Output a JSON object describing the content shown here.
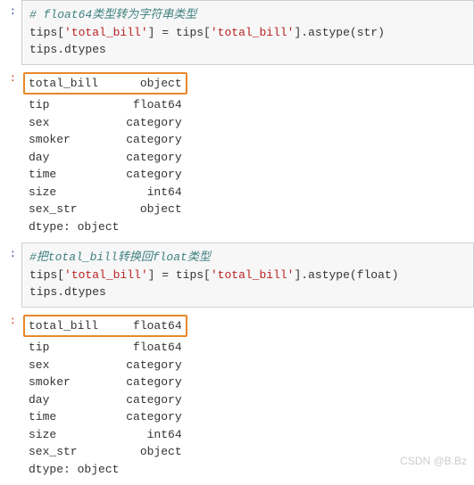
{
  "cell1": {
    "comment": "# float64类型转为字符串类型",
    "code_line1_a": "tips[",
    "code_line1_b": "'total_bill'",
    "code_line1_c": "] = tips[",
    "code_line1_d": "'total_bill'",
    "code_line1_e": "].astype(",
    "code_line1_f": "str",
    "code_line1_g": ")",
    "code_line2": "tips.dtypes"
  },
  "out1": {
    "highlight": "total_bill      object",
    "rows": [
      "tip            float64",
      "sex           category",
      "smoker        category",
      "day           category",
      "time          category",
      "size             int64",
      "sex_str         object",
      "dtype: object"
    ]
  },
  "cell2": {
    "comment": "#把total_bill转换回float类型",
    "code_line1_a": "tips[",
    "code_line1_b": "'total_bill'",
    "code_line1_c": "] = tips[",
    "code_line1_d": "'total_bill'",
    "code_line1_e": "].astype(",
    "code_line1_f": "float",
    "code_line1_g": ")",
    "code_line2": "tips.dtypes"
  },
  "out2": {
    "highlight": "total_bill     float64",
    "rows": [
      "tip            float64",
      "sex           category",
      "smoker        category",
      "day           category",
      "time          category",
      "size             int64",
      "sex_str         object",
      "dtype: object"
    ]
  },
  "prompt_in": ":",
  "prompt_out": ":",
  "watermark": "CSDN @B.Bz"
}
